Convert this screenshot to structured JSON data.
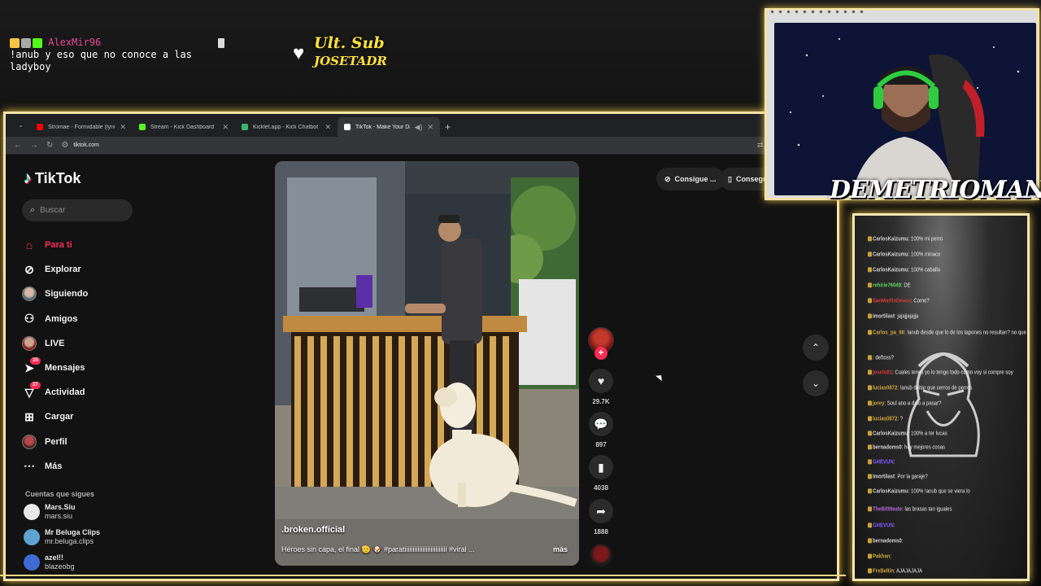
{
  "overlay": {
    "chat": {
      "username": "AlexMir96",
      "message": "!anub y eso que no conoce a las ladyboy"
    },
    "ult_sub": {
      "label": "Ult. Sub",
      "name": "JOSETADR"
    },
    "streamer_name": "DEMETRIOMAN"
  },
  "browser": {
    "tabs": [
      {
        "label": "Stromae - Formidable (lyrics) ·",
        "icon": "youtube-icon",
        "color": "#ff0000"
      },
      {
        "label": "Stream - Kick Dashboard",
        "icon": "kick-icon",
        "color": "#53fc18"
      },
      {
        "label": "Kicklet.app - Kick Chatbot and",
        "icon": "kicklet-icon",
        "color": "#3cb371"
      },
      {
        "label": "TikTok - Make Your Day",
        "icon": "tiktok-icon",
        "color": "#ffffff",
        "active": true
      }
    ],
    "url": "tiktok.com"
  },
  "tiktok": {
    "logo": "TikTok",
    "search_placeholder": "Buscar",
    "nav": [
      {
        "label": "Para ti",
        "icon": "home-icon",
        "active": true
      },
      {
        "label": "Explorar",
        "icon": "compass-icon"
      },
      {
        "label": "Siguiendo",
        "icon": "following-avatar-icon"
      },
      {
        "label": "Amigos",
        "icon": "friends-icon"
      },
      {
        "label": "LIVE",
        "icon": "live-avatar-icon"
      },
      {
        "label": "Mensajes",
        "icon": "send-icon",
        "badge": "15"
      },
      {
        "label": "Actividad",
        "icon": "inbox-icon",
        "badge": "37"
      },
      {
        "label": "Cargar",
        "icon": "upload-icon"
      },
      {
        "label": "Perfil",
        "icon": "profile-avatar-icon"
      },
      {
        "label": "Más",
        "icon": "more-icon"
      }
    ],
    "following_title": "Cuentas que sigues",
    "following": [
      {
        "name": "Mars.Siu",
        "handle": "mars.siu"
      },
      {
        "name": "Mr Beluga Clips",
        "handle": "mr.beluga.clips"
      },
      {
        "name": "azel!!",
        "handle": "blazeobg"
      }
    ],
    "pills": [
      "Consigue ...",
      "Consegui"
    ],
    "video": {
      "author": ".broken.official",
      "caption": "Héroes sin capa, el final 🫡 🐶 #paratiiiiiiiiiiiiiiiiiiiiiiiiii #viral ...",
      "more": "más"
    },
    "actions": {
      "likes": "29.7K",
      "comments": "897",
      "saves": "4038",
      "shares": "1888"
    }
  },
  "stream_chat": [
    {
      "name": "CarlosKaizumu",
      "msg": "100% mi perro",
      "color": "#d0d0d0"
    },
    {
      "name": "CarlosKaizumu",
      "msg": "100% minaco",
      "color": "#d0d0d0"
    },
    {
      "name": "CarlosKaizumu",
      "msg": "100% caballo",
      "color": "#d0d0d0"
    },
    {
      "name": "rehirie76049",
      "msg": "DE",
      "color": "#5fd35f"
    },
    {
      "name": "SanMartinDeuce",
      "msg": "Como?",
      "color": "#d43c3c"
    },
    {
      "name": "Imortilast",
      "msg": "jajajjajajja",
      "color": "#d0d0d0"
    },
    {
      "name": "Carlos_pa_66",
      "msg": "!anub desde que lo de los tapones no resultan? no que tenia esas cosas me hizo por esto?",
      "color": "#c9a33b"
    },
    {
      "name": "",
      "msg": "deftoss?",
      "color": "#d0d0d0"
    },
    {
      "name": "joselo81",
      "msg": "Cuales tenes yo lo tengo todo como voy si compre soy",
      "color": "#d43c3c"
    },
    {
      "name": "lucias0872",
      "msg": "!anub deitar que cerros de perros",
      "color": "#c9a33b"
    },
    {
      "name": "jorey",
      "msg": "Soul ano a dalo a pasar?",
      "color": "#c9a33b"
    },
    {
      "name": "lucias0872",
      "msg": "?",
      "color": "#c9a33b"
    },
    {
      "name": "CarlosKaizumu",
      "msg": "100% a ter lucas",
      "color": "#d0d0d0"
    },
    {
      "name": "bernadoms0",
      "msg": "hay mejores cosas",
      "color": "#d0d0d0"
    },
    {
      "name": "GHEVUN",
      "msg": "",
      "color": "#7b5cff"
    },
    {
      "name": "Imortilast",
      "msg": "Por la garaje?",
      "color": "#d0d0d0"
    },
    {
      "name": "CarlosKaizumu",
      "msg": "100% !anub que se viera lo",
      "color": "#d0d0d0"
    },
    {
      "name": "TheBitWaste",
      "msg": "las brasas tan iguales",
      "color": "#b06bd9"
    },
    {
      "name": "GHEVUN",
      "msg": "",
      "color": "#7b5cff"
    },
    {
      "name": "bernadoms0",
      "msg": "",
      "color": "#d0d0d0"
    },
    {
      "name": "Pakhan",
      "msg": "",
      "color": "#c9a33b"
    },
    {
      "name": "FreBeltin",
      "msg": "AJAJAJAJA",
      "color": "#c9a33b"
    }
  ]
}
